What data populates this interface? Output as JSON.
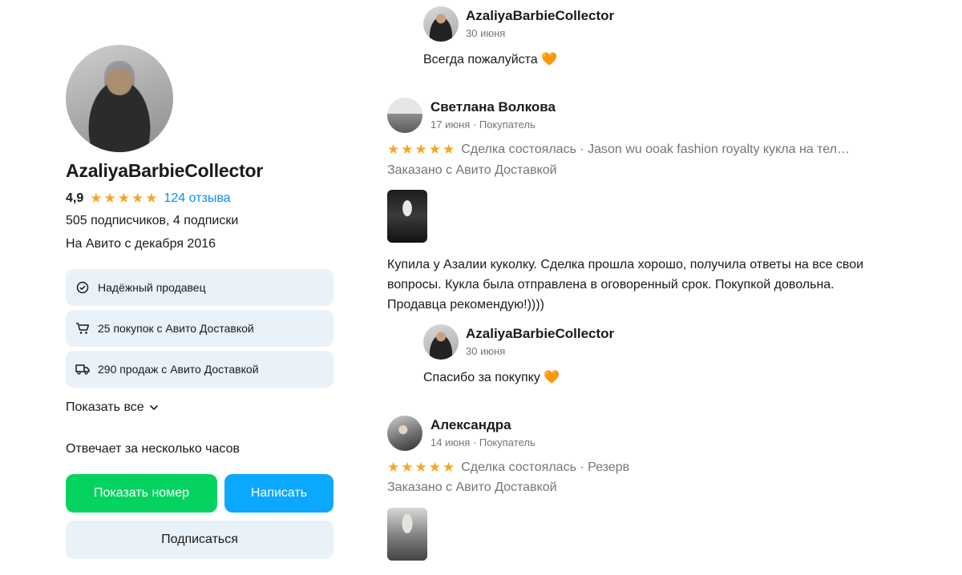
{
  "profile": {
    "name": "AzaliyaBarbieCollector",
    "rating": "4,9",
    "reviews_link": "124 отзыва",
    "subscribers": "505 подписчиков, 4 подписки",
    "since": "На Авито с декабря 2016",
    "badges": [
      {
        "label": "Надёжный продавец",
        "icon": "check-circle-icon"
      },
      {
        "label": "25 покупок с Авито Доставкой",
        "icon": "cart-icon"
      },
      {
        "label": "290 продаж с Авито Доставкой",
        "icon": "truck-icon"
      }
    ],
    "show_all": "Показать все",
    "response_time": "Отвечает за несколько часов",
    "buttons": {
      "show_phone": "Показать номер",
      "write": "Написать",
      "subscribe": "Подписаться"
    },
    "colors": {
      "accent_green": "#04d35f",
      "accent_blue": "#0aa8ff",
      "star": "#f5a623",
      "link": "#0a8ff0"
    }
  },
  "reviews": {
    "reply_top": {
      "author": "AzaliyaBarbieCollector",
      "date": "30 июня",
      "text": "Всегда пожалуйста 🧡"
    },
    "review_1": {
      "author": "Светлана Волкова",
      "meta": "17 июня · Покупатель",
      "rating": 5,
      "deal": "Сделка состоялась · Jason wu ooak fashion royalty кукла на тел…",
      "ordered": "Заказано с Авито Доставкой",
      "text": "Купила у Азалии куколку. Сделка прошла хорошо, получила ответы на все свои вопросы. Кукла была отправлена в оговоренный срок. Покупкой довольна. Продавца рекомендую!))))",
      "reply": {
        "author": "AzaliyaBarbieCollector",
        "date": "30 июня",
        "text": "Спасибо за покупку 🧡"
      }
    },
    "review_2": {
      "author": "Александра",
      "meta": "14 июня · Покупатель",
      "rating": 5,
      "deal": "Сделка состоялась · Резерв",
      "ordered": "Заказано с Авито Доставкой"
    }
  }
}
